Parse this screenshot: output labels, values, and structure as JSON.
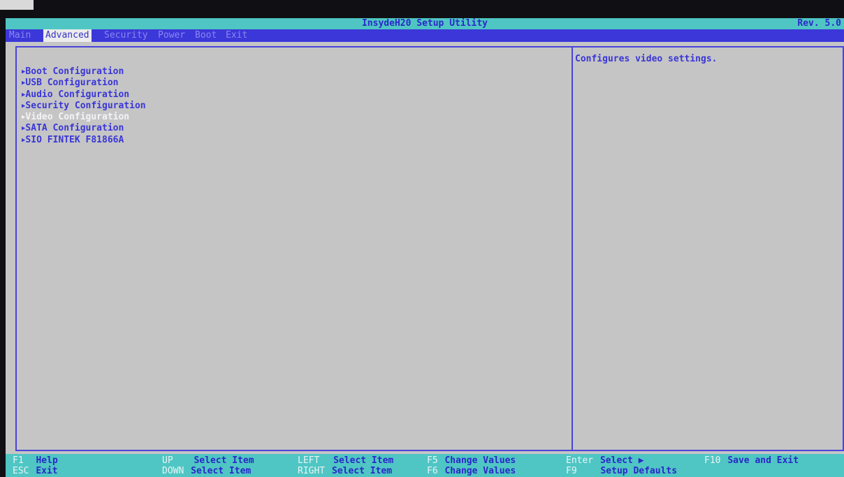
{
  "app": {
    "title": "InsydeH20 Setup Utility",
    "revision": "Rev. 5.0"
  },
  "tabs": [
    {
      "label": "Main",
      "active": false
    },
    {
      "label": "Advanced",
      "active": true
    },
    {
      "label": "Security",
      "active": false
    },
    {
      "label": "Power",
      "active": false
    },
    {
      "label": "Boot",
      "active": false
    },
    {
      "label": "Exit",
      "active": false
    }
  ],
  "menu": {
    "arrow": "▶",
    "items": [
      {
        "label": "Boot Configuration",
        "selected": false
      },
      {
        "label": "USB Configuration",
        "selected": false
      },
      {
        "label": "Audio Configuration",
        "selected": false
      },
      {
        "label": "Security Configuration",
        "selected": false
      },
      {
        "label": "Video Configuration",
        "selected": true
      },
      {
        "label": "SATA Configuration",
        "selected": false
      },
      {
        "label": "SIO FINTEK F81866A",
        "selected": false
      }
    ]
  },
  "help": {
    "text": "Configures video settings."
  },
  "footer": {
    "keys": [
      {
        "key": "F1",
        "desc": "Help"
      },
      {
        "key": "ESC",
        "desc": "Exit"
      },
      {
        "key": "UP",
        "desc": "Select Item"
      },
      {
        "key": "DOWN",
        "desc": "Select Item"
      },
      {
        "key": "LEFT",
        "desc": "Select Item"
      },
      {
        "key": "RIGHT",
        "desc": "Select Item"
      },
      {
        "key": "F5",
        "desc": "Change Values"
      },
      {
        "key": "F6",
        "desc": "Change Values"
      },
      {
        "key": "Enter",
        "desc": "Select ▶"
      },
      {
        "key": "F9",
        "desc": "Setup Defaults"
      },
      {
        "key": "F10",
        "desc": "Save and Exit"
      }
    ]
  },
  "colors": {
    "accent_cyan": "#4fc6c4",
    "menu_blue": "#3c37d8",
    "text_blue": "#3a36d6",
    "panel_gray": "#c5c5c6"
  }
}
